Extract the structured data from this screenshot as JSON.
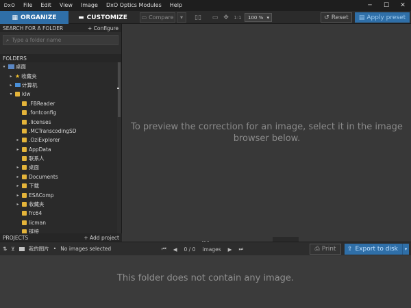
{
  "app": {
    "logo": "DxO"
  },
  "menu": [
    "File",
    "Edit",
    "View",
    "Image",
    "DxO Optics Modules",
    "Help"
  ],
  "window_controls": [
    "─",
    "☐",
    "✕"
  ],
  "toolbar": {
    "organize_label": "ORGANIZE",
    "customize_label": "CUSTOMIZE",
    "compare_label": "Compare",
    "one_to_one": "1:1",
    "zoom_value": "100 %",
    "reset_label": "Reset",
    "apply_preset_label": "Apply preset"
  },
  "left_panel": {
    "search_header": "SEARCH FOR A FOLDER",
    "configure_link": "+ Configure",
    "search_placeholder": "Type a folder name",
    "folders_header": "FOLDERS",
    "tree": [
      {
        "label": "桌面",
        "depth": 0,
        "arrow": "▾",
        "icon": "desktop"
      },
      {
        "label": "收藏夹",
        "depth": 1,
        "arrow": "▸",
        "icon": "star"
      },
      {
        "label": "计算机",
        "depth": 1,
        "arrow": "▸",
        "icon": "computer"
      },
      {
        "label": "klw",
        "depth": 1,
        "arrow": "▾",
        "icon": "folder"
      },
      {
        "label": ".FBReader",
        "depth": 2,
        "arrow": "",
        "icon": "folder"
      },
      {
        "label": ".fontconfig",
        "depth": 2,
        "arrow": "",
        "icon": "folder"
      },
      {
        "label": ".licenses",
        "depth": 2,
        "arrow": "",
        "icon": "folder"
      },
      {
        "label": ".MCTranscodingSD",
        "depth": 2,
        "arrow": "",
        "icon": "folder"
      },
      {
        "label": ".OziExplorer",
        "depth": 2,
        "arrow": "▸",
        "icon": "folder"
      },
      {
        "label": "AppData",
        "depth": 2,
        "arrow": "▸",
        "icon": "folder"
      },
      {
        "label": "联系人",
        "depth": 2,
        "arrow": "",
        "icon": "folder"
      },
      {
        "label": "桌面",
        "depth": 2,
        "arrow": "▸",
        "icon": "folder"
      },
      {
        "label": "Documents",
        "depth": 2,
        "arrow": "▸",
        "icon": "folder"
      },
      {
        "label": "下载",
        "depth": 2,
        "arrow": "▸",
        "icon": "folder"
      },
      {
        "label": "ESAComp",
        "depth": 2,
        "arrow": "▸",
        "icon": "folder"
      },
      {
        "label": "收藏夹",
        "depth": 2,
        "arrow": "▸",
        "icon": "folder"
      },
      {
        "label": "frc64",
        "depth": 2,
        "arrow": "",
        "icon": "folder"
      },
      {
        "label": "licman",
        "depth": 2,
        "arrow": "",
        "icon": "folder"
      },
      {
        "label": "链接",
        "depth": 2,
        "arrow": "",
        "icon": "folder"
      }
    ],
    "projects_header": "PROJECTS",
    "add_project_link": "+ Add project"
  },
  "viewer": {
    "message_line1": "To preview the correction for an image, select it in the image",
    "message_line2": "browser below."
  },
  "browser": {
    "folder_name": "我的图片",
    "selection_status": "No images selected",
    "page_counter": "0 / 0",
    "images_label": "images",
    "print_label": "Print",
    "export_label": "Export to disk",
    "empty_message": "This folder does not contain any image."
  },
  "colors": {
    "accent": "#2f6fa8",
    "background": "#3a3a3a",
    "menubar": "#1e1e1e",
    "folder_icon": "#e4b43a"
  }
}
